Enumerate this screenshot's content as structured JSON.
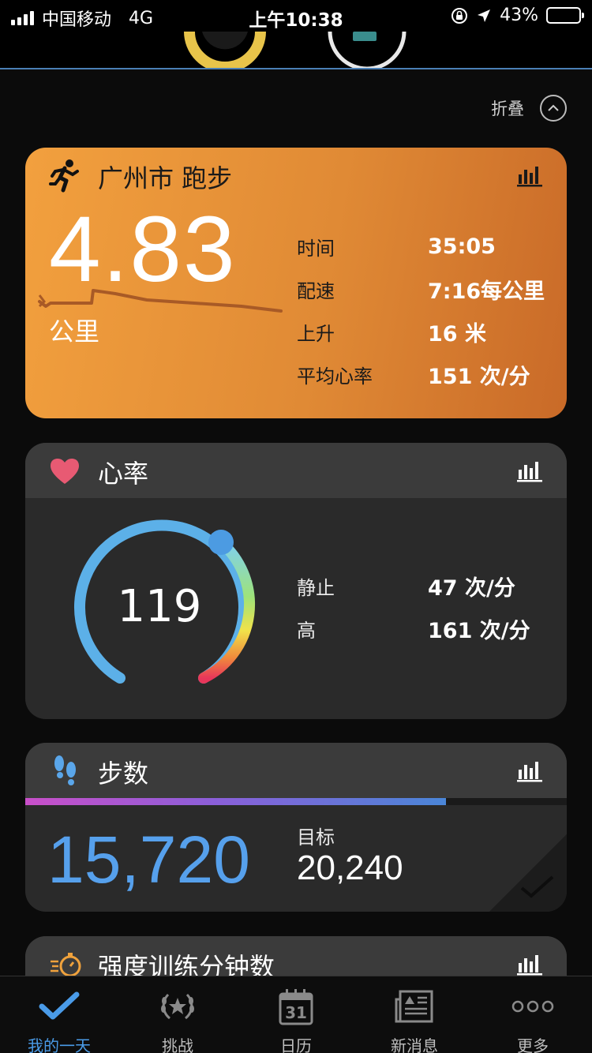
{
  "status_bar": {
    "carrier": "中国移动",
    "network": "4G",
    "time": "上午10:38",
    "battery_percent": "43%",
    "battery_level": 0.43
  },
  "collapse": {
    "label": "折叠"
  },
  "run_card": {
    "title": "广州市 跑步",
    "distance": "4.83",
    "distance_unit": "公里",
    "stats": [
      {
        "label": "时间",
        "value": "35:05"
      },
      {
        "label": "配速",
        "value": "7:16每公里"
      },
      {
        "label": "上升",
        "value": "16 米"
      },
      {
        "label": "平均心率",
        "value": "151 次/分"
      }
    ],
    "gradient_colors": [
      "#f2a03e",
      "#c96a28"
    ]
  },
  "heart_card": {
    "title": "心率",
    "current": "119",
    "stats": [
      {
        "label": "静止",
        "value": "47 次/分"
      },
      {
        "label": "高",
        "value": "161 次/分"
      }
    ],
    "accent": "#e85a73"
  },
  "steps_card": {
    "title": "步数",
    "value": "15,720",
    "goal_label": "目标",
    "goal_value": "20,240",
    "progress": 0.777,
    "value_color": "#56a0ec"
  },
  "intensity_card": {
    "title": "强度训练分钟数"
  },
  "tabbar": {
    "active_color": "#4a9be8",
    "items": [
      {
        "label": "我的一天",
        "icon": "checkmark-icon"
      },
      {
        "label": "挑战",
        "icon": "laurel-trophy-icon"
      },
      {
        "label": "日历",
        "icon": "calendar-icon",
        "badge": "31"
      },
      {
        "label": "新消息",
        "icon": "newspaper-icon"
      },
      {
        "label": "更多",
        "icon": "more-dots-icon"
      }
    ]
  }
}
